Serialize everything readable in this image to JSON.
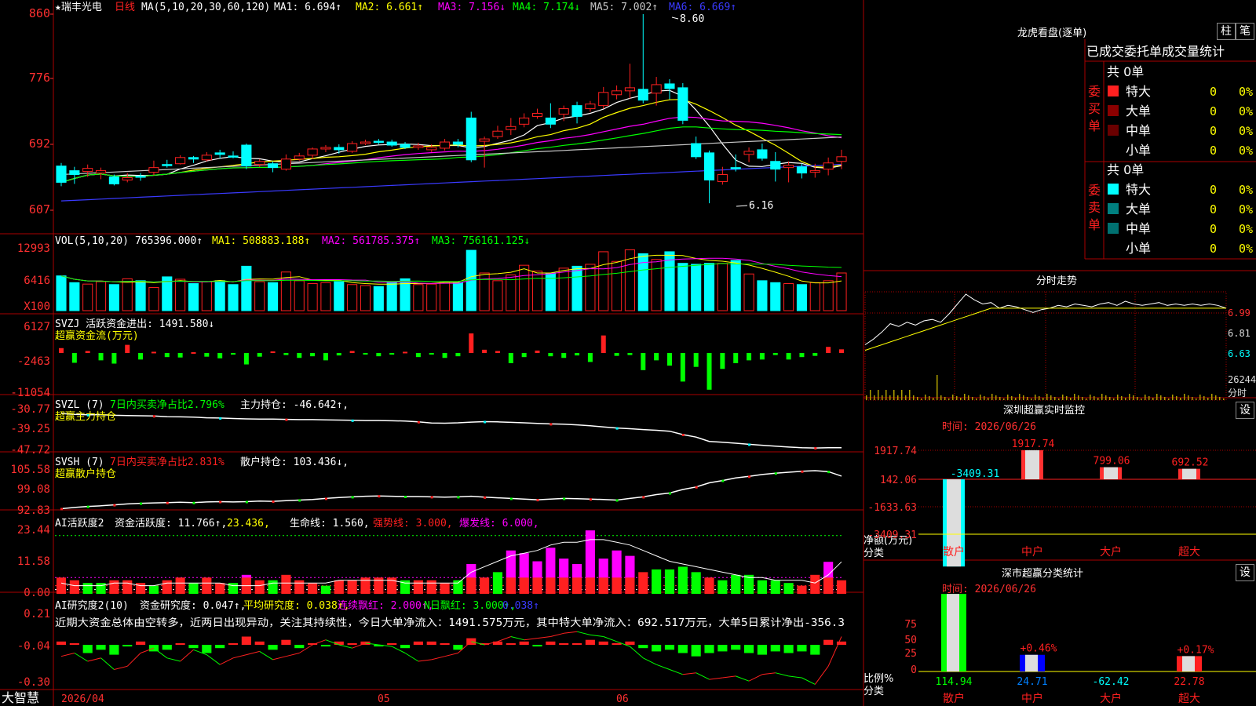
{
  "header": {
    "stock": "★瑞丰光电",
    "period": "日线",
    "ma_label": "MA(5,10,20,30,60,120)",
    "ma": [
      [
        "MA1: 6.694↑",
        "#ffffff"
      ],
      [
        "MA2: 6.661↑",
        "#ffff00"
      ],
      [
        "MA3: 7.156↓",
        "#ff00ff"
      ],
      [
        "MA4: 7.174↓",
        "#00ff00"
      ],
      [
        "MA5: 7.002↑",
        "#c8c8c8"
      ],
      [
        "MA6: 6.669↑",
        "#3a3aff"
      ]
    ]
  },
  "colors": {
    "up": "#ff2020",
    "down": "#00ffff",
    "grid": "#aa0000",
    "axis": "#ff3030",
    "green": "#00ff00",
    "magenta": "#ff00ff",
    "yellow": "#ffff00",
    "white": "#ffffff",
    "blue": "#3a3aff"
  },
  "price_axis": {
    "ticks": [
      "860",
      "776",
      "692",
      "607"
    ],
    "ylim": [
      6.07,
      8.6
    ],
    "high_label": "8.60",
    "low_label": "6.16"
  },
  "vol_panel": {
    "title": "VOL(5,10,20)",
    "value": "765396.000↑",
    "ma": [
      "MA1: 508883.188↑",
      "MA2: 561785.375↑",
      "MA3: 756161.125↓"
    ],
    "ticks": [
      "12993",
      "6416",
      "X100"
    ]
  },
  "svzj_panel": {
    "title": "SVZJ 活跃资金进出: 1491.580↓",
    "subtitle": "超赢资金流(万元)",
    "ticks": [
      "6127",
      "-2463",
      "-11054"
    ]
  },
  "svzl_panel": {
    "title": "SVZL (7)",
    "ratio": "7日内买卖净占比2.796%",
    "holding": "主力持仓: -46.642↑,",
    "subtitle": "超赢主力持仓",
    "ticks": [
      "-30.77",
      "-39.25",
      "-47.72"
    ]
  },
  "svsh_panel": {
    "title": "SVSH (7)",
    "ratio": "7日内买卖净占比2.831%",
    "holding": "散户持仓: 103.436↓,",
    "subtitle": "超赢散户持仓",
    "ticks": [
      "105.58",
      "99.08",
      "92.83"
    ]
  },
  "ai2_panel": {
    "title": "AI活跃度2",
    "parts": [
      [
        "资金活跃度: 11.766↑,",
        "#ffffff"
      ],
      [
        "23.436,",
        "#ffff00"
      ],
      [
        "生命线: 1.560,",
        "#ffffff"
      ],
      [
        "强势线: 3.000,",
        "#ff2020"
      ],
      [
        "爆发线: 6.000,",
        "#ff00ff"
      ]
    ],
    "ticks": [
      "23.44",
      "11.58",
      "0.00"
    ]
  },
  "ai_research": {
    "title": "AI研究度2(10)",
    "parts": [
      [
        "资金研究度: 0.047↑,",
        "#ffffff"
      ],
      [
        "平均研究度: 0.038↑,",
        "#ffff00"
      ],
      [
        "连续飘红: 2.000↑,",
        "#ff00ff"
      ],
      [
        "N日飘红: 3.000↑,",
        "#00ff00"
      ],
      [
        "0.038↑",
        "#3a3aff"
      ]
    ],
    "comment": "近期大资金总体由空转多，近两日出现异动，关注其持续性，今日大单净流入：1491.575万元，其中特大单净流入：692.517万元，大单5日累计净出-356.3",
    "ticks": [
      "0.21",
      "-0.04",
      "-0.30"
    ]
  },
  "date_axis": {
    "labels": [
      "2026/04",
      "05",
      "06"
    ],
    "brand": "大智慧"
  },
  "right": {
    "dragon_title": "龙虎看盘(逐单)",
    "btn_zhu": "柱",
    "btn_bi": "笔",
    "stats_title": "已成交委托单成交量统计",
    "buy_label": "委买单",
    "sell_label": "委卖单",
    "buy_total": "共 0单",
    "sell_total": "共 0单",
    "buy_rows": [
      [
        "特大",
        "0",
        "0%",
        "#ff2020"
      ],
      [
        "大单",
        "0",
        "0%",
        "#8b0000"
      ],
      [
        "中单",
        "0",
        "0%",
        "#6a0000"
      ],
      [
        "小单",
        "0",
        "0%",
        ""
      ]
    ],
    "sell_rows": [
      [
        "特大",
        "0",
        "0%",
        "#00ffff"
      ],
      [
        "大单",
        "0",
        "0%",
        "#008080"
      ],
      [
        "中单",
        "0",
        "0%",
        "#007070"
      ],
      [
        "小单",
        "0",
        "0%",
        ""
      ]
    ],
    "intraday_title": "分时走势",
    "intraday_ticks": [
      "6.99",
      "6.81",
      "6.63"
    ],
    "intraday_vol": "26244",
    "intraday_unit": "分时",
    "sz_monitor_title": "深圳超赢实时监控",
    "sz_time": "时间: 2026/06/26",
    "sz_ticks": [
      "1917.74",
      "142.06",
      "-1633.63",
      "-3409.31"
    ],
    "sz_bars": [
      {
        "cat": "散户",
        "value": -3409.31,
        "label": "-3409.31"
      },
      {
        "cat": "中户",
        "value": 1917.74,
        "label": "1917.74"
      },
      {
        "cat": "大户",
        "value": 799.06,
        "label": "799.06"
      },
      {
        "cat": "超大",
        "value": 692.52,
        "label": "692.52"
      }
    ],
    "sz_ylabel": "净额(万元)",
    "sz_xlabel": "分类",
    "btn_set1": "设",
    "sz_class_title": "深市超赢分类统计",
    "sz_class_time": "时间: 2026/06/26",
    "cls_ticks": [
      "75",
      "50",
      "25",
      "0"
    ],
    "cls_bars": [
      {
        "cat": "散户",
        "value": 114.94,
        "label": "114.94",
        "top": ""
      },
      {
        "cat": "中户",
        "value": 24.71,
        "label": "24.71",
        "top": "+0.46%"
      },
      {
        "cat": "大户",
        "value": -62.42,
        "label": "-62.42",
        "top": ""
      },
      {
        "cat": "超大",
        "value": 22.78,
        "label": "22.78",
        "top": "+0.17%"
      }
    ],
    "cls_ylabel": "比例%",
    "cls_xlabel": "分类",
    "btn_set2": "设"
  },
  "chart_data": {
    "type": "candlestick",
    "title": "瑞丰光电 日线",
    "x_labels": [
      "2026/04",
      "05",
      "06"
    ],
    "ylim": [
      6.07,
      8.6
    ],
    "candles": [
      [
        6.64,
        6.43,
        6.68,
        6.38
      ],
      [
        6.58,
        6.53,
        6.63,
        6.41
      ],
      [
        6.57,
        6.61,
        6.66,
        6.5
      ],
      [
        6.55,
        6.58,
        6.62,
        6.47
      ],
      [
        6.5,
        6.41,
        6.53,
        6.39
      ],
      [
        6.46,
        6.49,
        6.55,
        6.43
      ],
      [
        6.51,
        6.5,
        6.55,
        6.45
      ],
      [
        6.56,
        6.62,
        6.71,
        6.52
      ],
      [
        6.66,
        6.65,
        6.72,
        6.62
      ],
      [
        6.67,
        6.75,
        6.78,
        6.66
      ],
      [
        6.75,
        6.73,
        6.77,
        6.68
      ],
      [
        6.72,
        6.78,
        6.82,
        6.7
      ],
      [
        6.81,
        6.79,
        6.85,
        6.74
      ],
      [
        6.77,
        6.76,
        6.83,
        6.74
      ],
      [
        6.91,
        6.64,
        6.93,
        6.6
      ],
      [
        6.66,
        6.7,
        6.73,
        6.63
      ],
      [
        6.67,
        6.62,
        6.7,
        6.56
      ],
      [
        6.6,
        6.73,
        6.79,
        6.58
      ],
      [
        6.73,
        6.77,
        6.81,
        6.71
      ],
      [
        6.78,
        6.86,
        6.88,
        6.73
      ],
      [
        6.86,
        6.88,
        6.91,
        6.82
      ],
      [
        6.88,
        6.85,
        6.92,
        6.8
      ],
      [
        6.83,
        6.93,
        6.96,
        6.81
      ],
      [
        6.93,
        6.95,
        6.98,
        6.91
      ],
      [
        6.96,
        6.95,
        6.99,
        6.92
      ],
      [
        6.95,
        6.91,
        6.98,
        6.89
      ],
      [
        6.92,
        6.88,
        6.95,
        6.86
      ],
      [
        6.88,
        6.9,
        6.94,
        6.85
      ],
      [
        6.85,
        6.88,
        6.92,
        6.82
      ],
      [
        6.87,
        6.95,
        6.99,
        6.84
      ],
      [
        6.95,
        6.92,
        6.99,
        6.88
      ],
      [
        7.26,
        6.72,
        7.34,
        6.69
      ],
      [
        6.96,
        6.99,
        7.02,
        6.62
      ],
      [
        7.02,
        7.09,
        7.16,
        6.99
      ],
      [
        7.11,
        7.15,
        7.26,
        7.04
      ],
      [
        7.18,
        7.26,
        7.32,
        7.14
      ],
      [
        7.28,
        7.32,
        7.38,
        7.25
      ],
      [
        7.26,
        7.18,
        7.45,
        7.13
      ],
      [
        7.31,
        7.38,
        7.42,
        7.22
      ],
      [
        7.42,
        7.28,
        7.47,
        7.19
      ],
      [
        7.38,
        7.44,
        7.48,
        7.34
      ],
      [
        7.42,
        7.59,
        7.66,
        7.38
      ],
      [
        7.56,
        7.61,
        7.68,
        7.5
      ],
      [
        7.61,
        7.65,
        7.96,
        7.51
      ],
      [
        7.63,
        7.49,
        8.6,
        7.45
      ],
      [
        7.58,
        7.69,
        7.79,
        7.42
      ],
      [
        7.7,
        7.64,
        7.76,
        7.5
      ],
      [
        7.65,
        7.23,
        7.71,
        7.18
      ],
      [
        6.93,
        6.76,
        7.02,
        6.73
      ],
      [
        6.81,
        6.46,
        6.84,
        6.16
      ],
      [
        6.44,
        6.53,
        6.63,
        6.4
      ],
      [
        6.62,
        6.61,
        6.79,
        6.57
      ],
      [
        6.79,
        6.83,
        6.88,
        6.69
      ],
      [
        6.85,
        6.74,
        6.93,
        6.71
      ],
      [
        6.7,
        6.6,
        6.82,
        6.44
      ],
      [
        6.62,
        6.65,
        6.7,
        6.43
      ],
      [
        6.63,
        6.55,
        6.67,
        6.48
      ],
      [
        6.56,
        6.58,
        6.67,
        6.49
      ],
      [
        6.6,
        6.68,
        6.75,
        6.52
      ],
      [
        6.7,
        6.76,
        6.85,
        6.6
      ]
    ],
    "volume": [
      72,
      58,
      55,
      60,
      54,
      66,
      62,
      48,
      70,
      65,
      56,
      60,
      62,
      54,
      92,
      60,
      58,
      80,
      62,
      56,
      58,
      60,
      54,
      52,
      50,
      58,
      66,
      54,
      55,
      60,
      58,
      125,
      78,
      62,
      74,
      94,
      82,
      78,
      88,
      92,
      96,
      122,
      102,
      126,
      118,
      106,
      122,
      98,
      96,
      98,
      98,
      104,
      76,
      62,
      58,
      56,
      54,
      58,
      62,
      78
    ],
    "flow": [
      1.2,
      -2.4,
      0.5,
      -1.8,
      -2.6,
      2.0,
      -1.6,
      0.3,
      -1.0,
      -1.1,
      0.2,
      -0.9,
      -1.3,
      -0.4,
      -2.8,
      -0.9,
      0.4,
      -0.5,
      -1.2,
      -0.8,
      -1.8,
      -0.6,
      0.5,
      -0.3,
      -0.8,
      -0.4,
      0.3,
      -1.0,
      -0.2,
      -1.2,
      -0.8,
      4.8,
      0.8,
      0.5,
      -2.5,
      -1.0,
      0.6,
      -0.8,
      -1.2,
      -0.6,
      -2.2,
      4.3,
      -0.7,
      -0.5,
      -4.2,
      -1.8,
      -3.1,
      -7.0,
      -3.4,
      -9.0,
      -3.9,
      -2.5,
      -1.8,
      -1.6,
      -0.5,
      -1.6,
      -1.0,
      -0.7,
      1.5,
      0.9
    ],
    "zhuli": [
      -31.5,
      -31.9,
      -32.1,
      -32.0,
      -32.3,
      -32.4,
      -32.5,
      -32.6,
      -32.9,
      -33.0,
      -33.1,
      -33.4,
      -33.5,
      -33.7,
      -33.9,
      -34.0,
      -34.0,
      -34.1,
      -34.2,
      -34.2,
      -34.3,
      -34.4,
      -34.5,
      -34.6,
      -34.6,
      -34.7,
      -34.8,
      -35.2,
      -35.7,
      -35.8,
      -35.6,
      -35.3,
      -35.1,
      -35.2,
      -35.4,
      -35.6,
      -35.9,
      -36.1,
      -36.2,
      -36.5,
      -36.9,
      -37.4,
      -37.9,
      -38.2,
      -38.6,
      -38.9,
      -39.3,
      -40.8,
      -41.9,
      -43.8,
      -44.2,
      -44.6,
      -45.1,
      -45.5,
      -45.9,
      -46.3,
      -46.6,
      -46.7,
      -46.6,
      -46.6
    ],
    "sanhu": [
      93.2,
      93.6,
      93.9,
      94.1,
      94.4,
      94.7,
      94.9,
      95.0,
      95.1,
      95.2,
      95.1,
      95.3,
      95.4,
      95.3,
      95.4,
      95.6,
      95.5,
      95.7,
      95.9,
      96.1,
      96.4,
      96.7,
      96.9,
      97.1,
      97.2,
      97.1,
      97.0,
      97.0,
      96.9,
      96.8,
      96.9,
      97.1,
      96.8,
      96.6,
      96.4,
      96.2,
      96.0,
      96.2,
      96.4,
      96.3,
      96.2,
      96.1,
      95.9,
      96.4,
      96.9,
      97.6,
      98.1,
      99.2,
      100.0,
      101.3,
      102.0,
      102.8,
      103.3,
      103.9,
      104.3,
      104.6,
      104.9,
      105.1,
      104.8,
      103.4
    ],
    "active_ma": [
      4,
      3,
      3,
      3,
      4,
      4,
      3,
      3,
      4,
      4,
      4,
      4,
      4,
      3,
      3,
      3,
      4,
      4,
      4,
      4,
      4,
      5,
      5,
      5,
      5,
      5,
      4,
      4,
      4,
      4,
      4,
      8,
      10,
      12,
      14,
      15,
      16,
      18,
      19,
      19,
      20,
      20,
      19,
      18,
      16,
      14,
      12,
      11,
      10,
      9,
      8,
      7,
      6,
      6,
      5,
      5,
      5,
      4,
      7,
      11.8
    ],
    "active": [
      {
        "v": 6,
        "t": "r"
      },
      {
        "v": 5,
        "t": "r"
      },
      {
        "v": 4,
        "t": "g"
      },
      {
        "v": 4,
        "t": "g"
      },
      {
        "v": 5,
        "t": "r"
      },
      {
        "v": 5,
        "t": "r"
      },
      {
        "v": 4,
        "t": "r"
      },
      {
        "v": 3,
        "t": "g"
      },
      {
        "v": 5,
        "t": "r"
      },
      {
        "v": 6,
        "t": "r"
      },
      {
        "v": 4,
        "t": "g"
      },
      {
        "v": 6,
        "t": "r"
      },
      {
        "v": 4,
        "t": "r"
      },
      {
        "v": 4,
        "t": "g"
      },
      {
        "v": 7,
        "t": "m"
      },
      {
        "v": 5,
        "t": "r"
      },
      {
        "v": 5,
        "t": "g"
      },
      {
        "v": 7,
        "t": "r"
      },
      {
        "v": 5,
        "t": "r"
      },
      {
        "v": 4,
        "t": "r"
      },
      {
        "v": 3,
        "t": "g"
      },
      {
        "v": 5,
        "t": "r"
      },
      {
        "v": 5,
        "t": "r"
      },
      {
        "v": 6,
        "t": "r"
      },
      {
        "v": 6,
        "t": "r"
      },
      {
        "v": 6,
        "t": "r"
      },
      {
        "v": 5,
        "t": "g"
      },
      {
        "v": 5,
        "t": "r"
      },
      {
        "v": 5,
        "t": "r"
      },
      {
        "v": 4,
        "t": "r"
      },
      {
        "v": 5,
        "t": "g"
      },
      {
        "v": 11,
        "t": "m"
      },
      {
        "v": 6,
        "t": "r"
      },
      {
        "v": 8,
        "t": "g"
      },
      {
        "v": 16,
        "t": "m"
      },
      {
        "v": 15,
        "t": "m"
      },
      {
        "v": 12,
        "t": "m"
      },
      {
        "v": 17,
        "t": "m"
      },
      {
        "v": 13,
        "t": "m"
      },
      {
        "v": 11,
        "t": "m"
      },
      {
        "v": 23.4,
        "t": "m"
      },
      {
        "v": 13,
        "t": "m"
      },
      {
        "v": 16,
        "t": "m"
      },
      {
        "v": 14,
        "t": "m"
      },
      {
        "v": 8,
        "t": "r"
      },
      {
        "v": 9,
        "t": "g"
      },
      {
        "v": 9,
        "t": "g"
      },
      {
        "v": 10,
        "t": "g"
      },
      {
        "v": 8,
        "t": "g"
      },
      {
        "v": 6,
        "t": "r"
      },
      {
        "v": 5,
        "t": "g"
      },
      {
        "v": 7,
        "t": "g"
      },
      {
        "v": 7,
        "t": "g"
      },
      {
        "v": 5,
        "t": "g"
      },
      {
        "v": 5,
        "t": "g"
      },
      {
        "v": 4,
        "t": "g"
      },
      {
        "v": 3,
        "t": "r"
      },
      {
        "v": 7,
        "t": "r"
      },
      {
        "v": 11.8,
        "t": "m"
      },
      {
        "v": 5,
        "t": "r"
      }
    ],
    "research": [
      0.02,
      0.01,
      -0.05,
      -0.03,
      -0.06,
      -0.01,
      0.02,
      -0.04,
      -0.03,
      0.01,
      -0.02,
      -0.05,
      -0.02,
      0.01,
      0.05,
      0.02,
      -0.03,
      0.03,
      -0.02,
      0.01,
      -0.01,
      0.02,
      0.01,
      0.02,
      -0.01,
      0.01,
      -0.02,
      0.02,
      0.02,
      0.01,
      -0.03,
      0.04,
      0.01,
      0.02,
      0.01,
      0.02,
      -0.01,
      0.02,
      0.01,
      0.01,
      0.03,
      0.02,
      0.01,
      0.02,
      -0.02,
      -0.04,
      -0.03,
      -0.05,
      -0.07,
      -0.05,
      -0.04,
      -0.03,
      -0.05,
      -0.06,
      -0.04,
      -0.05,
      -0.04,
      -0.06,
      0.03,
      0.02
    ],
    "research_line": [
      -0.07,
      -0.05,
      -0.1,
      -0.08,
      -0.15,
      -0.13,
      -0.05,
      -0.02,
      -0.08,
      -0.1,
      -0.03,
      -0.06,
      -0.12,
      -0.08,
      -0.06,
      -0.04,
      -0.09,
      -0.07,
      -0.05,
      0.0,
      0.03,
      0.0,
      -0.02,
      0.01,
      0.0,
      -0.01,
      -0.05,
      -0.1,
      -0.09,
      -0.07,
      -0.05,
      0.02,
      0.0,
      0.02,
      0.05,
      0.03,
      0.04,
      0.05,
      0.07,
      0.08,
      0.06,
      0.05,
      0.02,
      -0.01,
      -0.08,
      -0.12,
      -0.15,
      -0.18,
      -0.17,
      -0.21,
      -0.2,
      -0.19,
      -0.22,
      -0.18,
      -0.17,
      -0.19,
      -0.2,
      -0.24,
      -0.13,
      0.05
    ],
    "intraday": [
      6.7,
      6.74,
      6.79,
      6.85,
      6.83,
      6.86,
      6.84,
      6.87,
      6.88,
      6.86,
      6.92,
      6.99,
      7.06,
      7.02,
      6.99,
      7.0,
      6.96,
      6.98,
      6.97,
      6.95,
      6.93,
      6.95,
      6.96,
      6.98,
      6.97,
      6.99,
      6.98,
      6.97,
      6.99,
      7.0,
      6.98,
      7.01,
      6.99,
      6.98,
      6.99,
      7.0,
      6.98,
      6.99,
      6.98,
      6.99,
      6.98,
      6.99,
      6.98,
      6.96
    ]
  }
}
